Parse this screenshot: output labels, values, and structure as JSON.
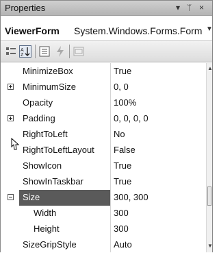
{
  "window": {
    "title": "Properties",
    "pin_glyph": "▾ ❘ ×"
  },
  "object_selector": {
    "name": "ViewerForm",
    "type": "System.Windows.Forms.Form"
  },
  "toolbar": {
    "buttons": [
      {
        "icon": "categorized-icon"
      },
      {
        "icon": "alphabetical-icon",
        "active": true
      },
      {
        "icon": "properties-icon"
      },
      {
        "icon": "events-icon"
      },
      {
        "icon": "property-pages-icon"
      }
    ]
  },
  "properties": [
    {
      "name": "MinimizeBox",
      "value": "True"
    },
    {
      "name": "MinimumSize",
      "value": "0, 0",
      "expander": "plus"
    },
    {
      "name": "Opacity",
      "value": "100%"
    },
    {
      "name": "Padding",
      "value": "0, 0, 0, 0",
      "expander": "plus"
    },
    {
      "name": "RightToLeft",
      "value": "No"
    },
    {
      "name": "RightToLeftLayout",
      "value": "False"
    },
    {
      "name": "ShowIcon",
      "value": "True"
    },
    {
      "name": "ShowInTaskbar",
      "value": "True"
    },
    {
      "name": "Size",
      "value": "300, 300",
      "expander": "minus",
      "selected": true
    },
    {
      "name": "Width",
      "value": "300",
      "child": true
    },
    {
      "name": "Height",
      "value": "300",
      "child": true
    },
    {
      "name": "SizeGripStyle",
      "value": "Auto"
    }
  ],
  "colors": {
    "selection": "#5a5a5a",
    "titlebar": "#bcbcbc"
  }
}
